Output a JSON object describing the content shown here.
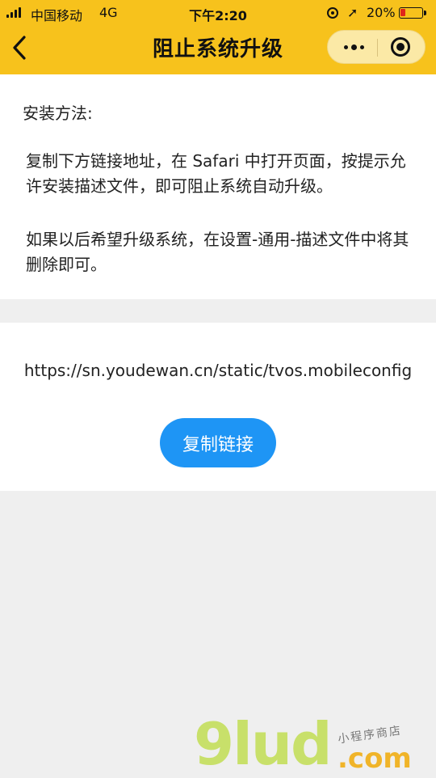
{
  "status_bar": {
    "carrier": "中国移动",
    "network": "4G",
    "time": "下午2:20",
    "battery_percent": "20%",
    "icons": [
      "signal-icon",
      "orientation-lock-icon",
      "location-icon",
      "battery-icon"
    ]
  },
  "nav": {
    "title": "阻止系统升级",
    "back_icon": "chevron-left-icon",
    "more_icon": "more-icon",
    "close_icon": "close-miniprogram-icon"
  },
  "instructions": {
    "heading": "安装方法:",
    "paragraph1": "复制下方链接地址，在 Safari 中打开页面，按提示允许安装描述文件，即可阻止系统自动升级。",
    "paragraph2": "如果以后希望升级系统，在设置-通用-描述文件中将其删除即可。"
  },
  "link_section": {
    "url": "https://sn.youdewan.cn/static/tvos.mobileconfig",
    "copy_button_label": "复制链接"
  },
  "watermark": {
    "logo": "9lud",
    "suffix": ".com",
    "tagline": "小程序商店"
  },
  "colors": {
    "header": "#f7c21c",
    "button": "#1e95f5",
    "battery_low": "#e0261b"
  }
}
